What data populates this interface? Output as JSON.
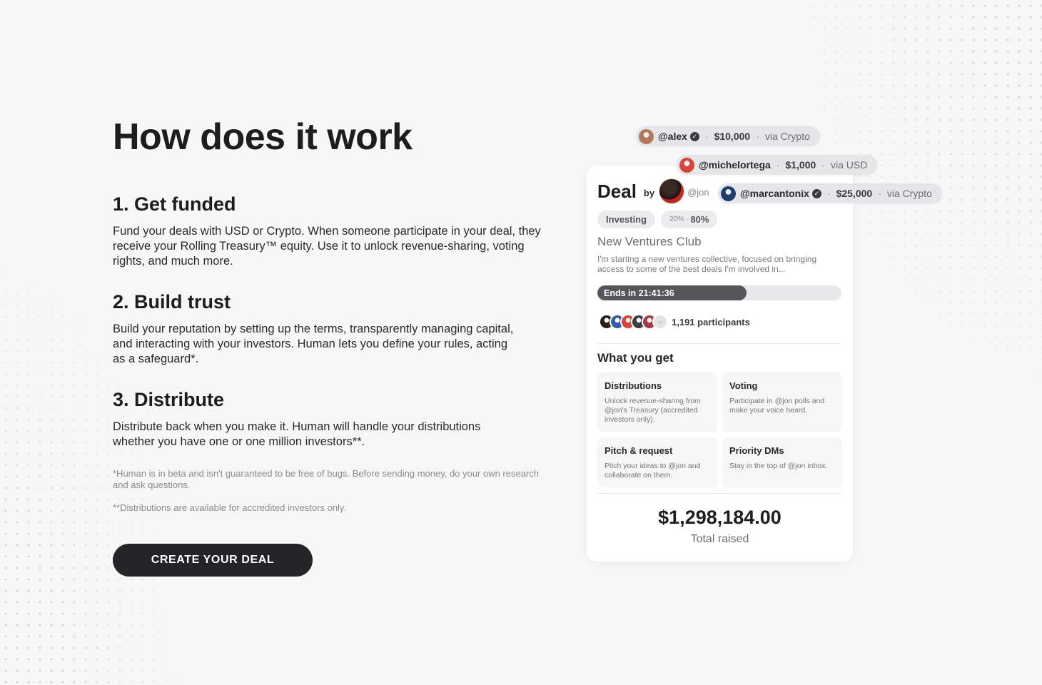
{
  "section": {
    "title": "How does it work",
    "steps": [
      {
        "title": "1. Get funded",
        "text": "Fund your deals with USD or Crypto. When someone participate in your deal, they receive your Rolling Treasury™ equity. Use it to unlock revenue-sharing, voting rights, and much more."
      },
      {
        "title": "2. Build trust",
        "text": "Build your reputation by setting up the terms, transparently managing capital, and interacting with your investors. Human lets you define your rules, acting as a safeguard*."
      },
      {
        "title": "3. Distribute",
        "text": "Distribute back when you make it. Human will handle your distributions whether you have one or one million investors**."
      }
    ],
    "notes": [
      "*Human is in beta and isn't guaranteed to be free of bugs. Before sending money, do your own research and ask questions.",
      "**Distributions are available for accredited investors only."
    ],
    "cta_label": "CREATE YOUR DEAL"
  },
  "contributions": [
    {
      "user": "@alex",
      "verified": true,
      "amount": "$10,000",
      "via": "via Crypto",
      "avatar_color": "#b07a5a"
    },
    {
      "user": "@michelortega",
      "verified": false,
      "amount": "$1,000",
      "via": "via USD",
      "avatar_color": "#d9433a"
    },
    {
      "user": "@marcantonix",
      "verified": true,
      "amount": "$25,000",
      "via": "via Crypto",
      "avatar_color": "#1c3d6e"
    }
  ],
  "deal": {
    "title": "Deal",
    "by": "by",
    "handle": "@jon",
    "tags": {
      "category": "Investing",
      "split_small": "20%",
      "split_sep": "·",
      "split_main": "80%"
    },
    "club_name": "New Ventures Club",
    "description": "I'm starting a new ventures collective, focused on bringing access to some of the best deals I'm involved in...",
    "timer": "Ends in 21:41:36",
    "progress": 0.61,
    "participants_label": "1,191 participants",
    "participant_colors": [
      "#2b1d1a",
      "#2e5fa8",
      "#d9433a",
      "#3b3b40",
      "#a33a45"
    ],
    "more_icon": "···",
    "what_you_get": "What you get",
    "benefits": [
      {
        "title": "Distributions",
        "text": "Unlock revenue-sharing from @jon's Treasury (accredited investors only)."
      },
      {
        "title": "Voting",
        "text": "Participate in @jon polls and make your voice heard."
      },
      {
        "title": "Pitch & request",
        "text": "Pitch your ideas to @jon and collaborate on them."
      },
      {
        "title": "Priority DMs",
        "text": "Stay in the top of @jon inbox."
      }
    ],
    "total_amount": "$1,298,184.00",
    "total_label": "Total raised"
  },
  "colors": {
    "background": "#f7f7f7",
    "cta": "#232328",
    "progress_fill": "#55555b",
    "pill": "#e6e6e8"
  }
}
